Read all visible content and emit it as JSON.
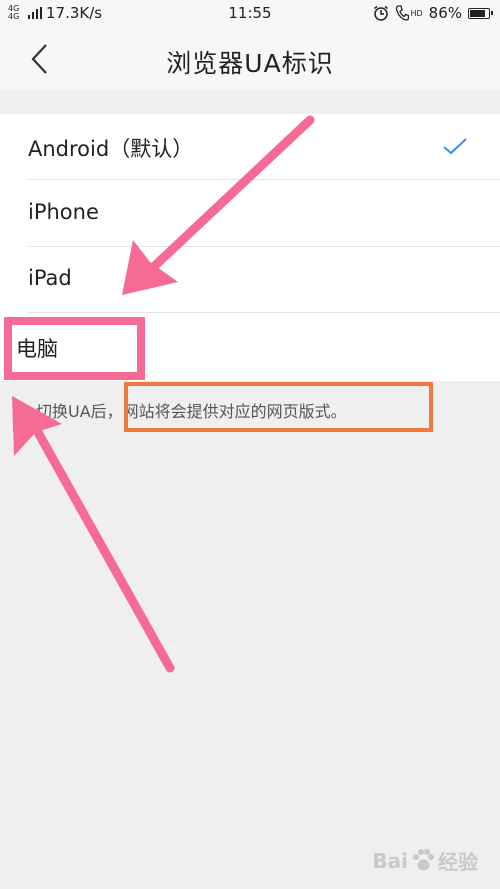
{
  "status_bar": {
    "network_tag": "4G 4G",
    "speed": "17.3K/s",
    "time": "11:55",
    "hd_tag": "HD",
    "battery": "86%",
    "battery_level": 0.86
  },
  "header": {
    "title": "浏览器UA标识",
    "back_icon": "chevron-left-icon"
  },
  "ua_options": [
    {
      "label": "Android（默认）",
      "selected": true
    },
    {
      "label": "iPhone",
      "selected": false
    },
    {
      "label": "iPad",
      "selected": false
    },
    {
      "label": "电脑",
      "selected": false
    }
  ],
  "hint_text": "切换UA后，网站将会提供对应的网页版式。",
  "watermark": {
    "left": "Bai",
    "right": "经验"
  },
  "colors": {
    "check": "#3a8ee6",
    "annotation_pink": "#f56b95",
    "annotation_orange": "#f07a3c"
  }
}
